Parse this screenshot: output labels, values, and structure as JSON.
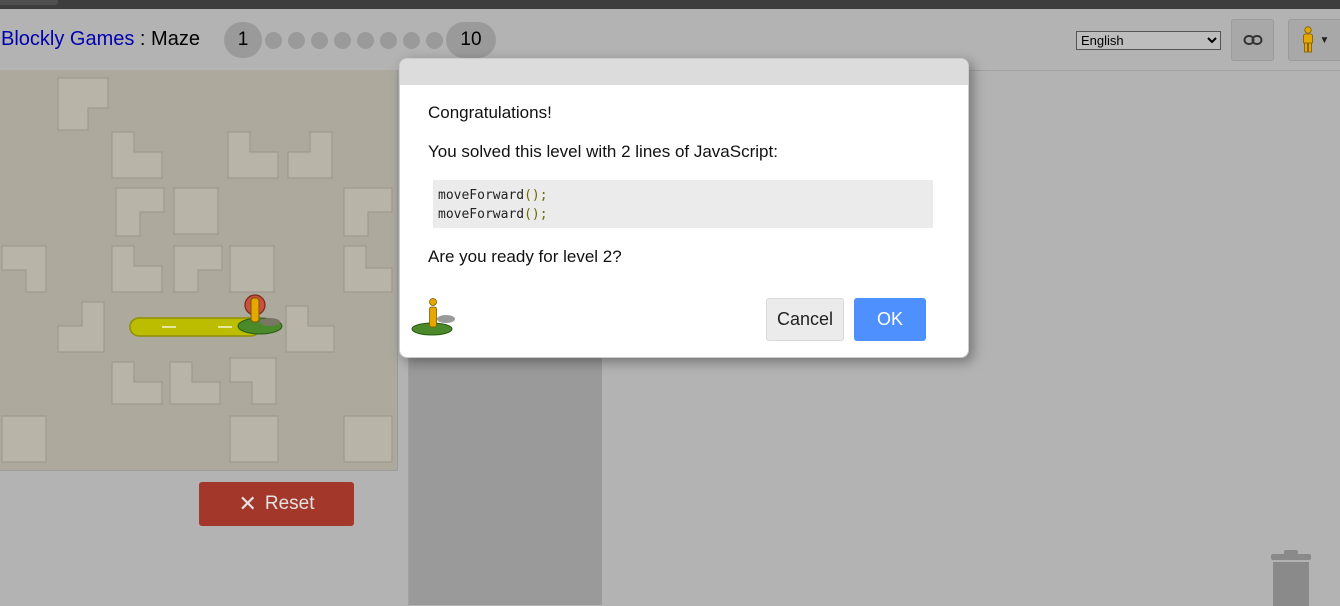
{
  "app": {
    "brand": "Blockly Games",
    "separator": " : ",
    "game": "Maze"
  },
  "levels": {
    "first": "1",
    "last": "10",
    "dot_count": 8,
    "current": 1
  },
  "language": {
    "selected": "English"
  },
  "icons": {
    "link": "link-icon",
    "avatar": "pegman-icon",
    "trash": "trash-icon",
    "reset": "x-icon"
  },
  "controls": {
    "reset_label": "Reset"
  },
  "dialog": {
    "heading": "Congratulations!",
    "summary": "You solved this level with 2 lines of JavaScript:",
    "code_lines": [
      {
        "fn": "moveForward",
        "punc": "();"
      },
      {
        "fn": "moveForward",
        "punc": "();"
      }
    ],
    "question": "Are you ready for level 2?",
    "cancel_label": "Cancel",
    "ok_label": "OK"
  },
  "colors": {
    "brand_link": "#0000b3",
    "ok_button": "#4d90fe",
    "reset_button": "#a3372a",
    "path": "#bcbc00",
    "pegman": "#e6a800",
    "goal_marker": "#c8503c"
  }
}
